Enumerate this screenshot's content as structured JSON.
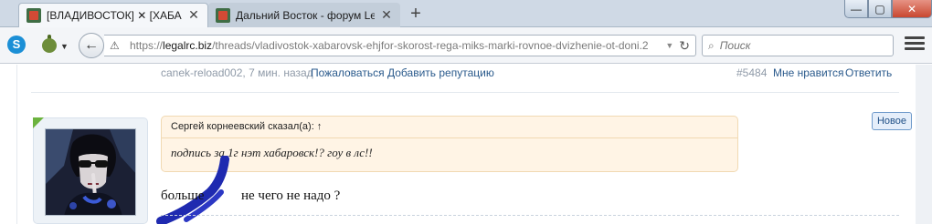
{
  "browser": {
    "tabs": [
      {
        "title": "[ВЛАДИВОСТОК] ✕ [ХАБАРОВСК]",
        "active": true
      },
      {
        "title": "Дальний Восток - форум LegalRC",
        "active": false
      }
    ],
    "new_tab": "+",
    "window_controls": {
      "minimize": "—",
      "maximize": "▢",
      "close": "✕"
    },
    "url": {
      "scheme": "https://",
      "host": "legalrc.biz",
      "path": "/threads/vladivostok-xabarovsk-ehjfor-skorost-rega-miks-marki-rovnoe-dvizhenie-ot-doni.2"
    },
    "search": {
      "placeholder": "Поиск"
    },
    "icons": {
      "s": "S",
      "back": "←",
      "warning": "⚠",
      "dropdown": "▼",
      "reload": "↻",
      "search": "🔍"
    }
  },
  "post_meta": {
    "author_time": "canek-reload002, 7 мин. назад",
    "report": "Пожаловаться",
    "add_reputation": "Добавить репутацию",
    "post_number": "#5484",
    "dislike": "Мне нравится",
    "reply": "Ответить"
  },
  "new_badge": "Новое",
  "quote": {
    "header": "Сергей корнеевский сказал(а): ↑",
    "text": "подпись за 1г нэт хабаровск!? гоу в лс!!"
  },
  "message": {
    "part1": "больше",
    "part2": "не чего не надо ?"
  },
  "colors": {
    "link": "#2a5a8c",
    "muted": "#8f9aa8",
    "quote_bg": "#fff4e5",
    "online": "#6cb33f",
    "stroke": "#1f2ab0"
  }
}
